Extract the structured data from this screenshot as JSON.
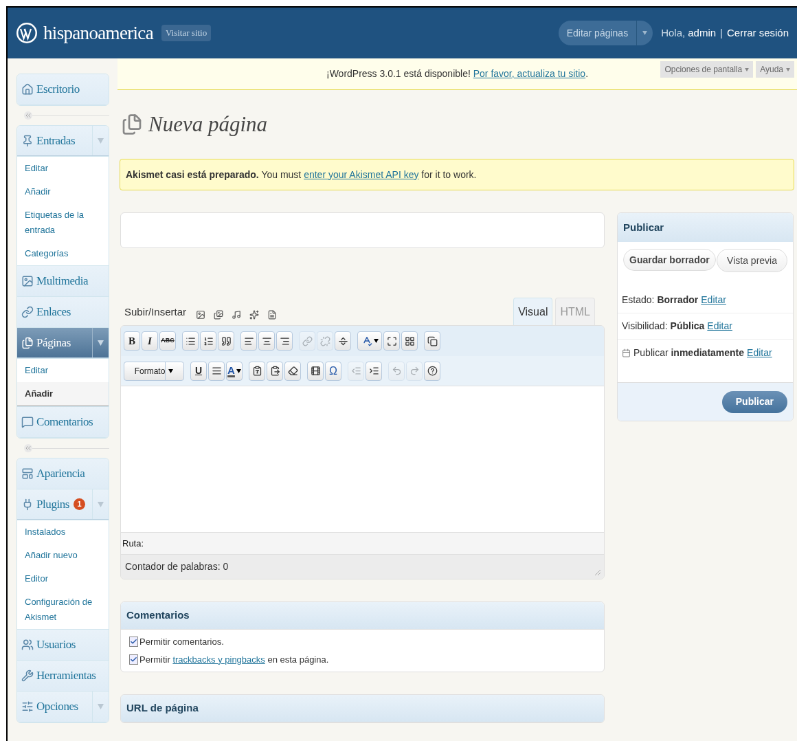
{
  "header": {
    "site_name": "hispanoamerica",
    "visit_site": "Visitar sitio",
    "favorite_action": "Editar páginas",
    "greeting": "Hola,",
    "user": "admin",
    "separator": "|",
    "logout": "Cerrar sesión"
  },
  "sidebar": {
    "groups": [
      {
        "items": [
          {
            "label": "Escritorio",
            "selected": false,
            "has_toggle": false,
            "expanded": false
          }
        ]
      },
      {
        "items": [
          {
            "label": "Entradas",
            "selected": false,
            "has_toggle": true,
            "expanded": true,
            "children": [
              {
                "label": "Editar",
                "selected": false
              },
              {
                "label": "Añadir",
                "selected": false
              },
              {
                "label": "Etiquetas de la entrada",
                "selected": false
              },
              {
                "label": "Categorías",
                "selected": false
              }
            ]
          },
          {
            "label": "Multimedia",
            "selected": false,
            "has_toggle": false,
            "expanded": false
          },
          {
            "label": "Enlaces",
            "selected": false,
            "has_toggle": false,
            "expanded": false
          },
          {
            "label": "Páginas",
            "selected": true,
            "has_toggle": true,
            "expanded": true,
            "children": [
              {
                "label": "Editar",
                "selected": false
              },
              {
                "label": "Añadir",
                "selected": true
              }
            ]
          },
          {
            "label": "Comentarios",
            "selected": false,
            "has_toggle": false,
            "expanded": false
          }
        ]
      },
      {
        "items": [
          {
            "label": "Apariencia",
            "selected": false,
            "has_toggle": false,
            "expanded": false
          },
          {
            "label": "Plugins",
            "selected": false,
            "has_toggle": true,
            "expanded": true,
            "badge": "1",
            "children": [
              {
                "label": "Instalados",
                "selected": false
              },
              {
                "label": "Añadir nuevo",
                "selected": false
              },
              {
                "label": "Editor",
                "selected": false
              },
              {
                "label": "Configuración de Akismet",
                "selected": false
              }
            ]
          },
          {
            "label": "Usuarios",
            "selected": false,
            "has_toggle": false,
            "expanded": false
          },
          {
            "label": "Herramientas",
            "selected": false,
            "has_toggle": false,
            "expanded": false
          },
          {
            "label": "Opciones",
            "selected": false,
            "has_toggle": true,
            "expanded": false
          }
        ]
      }
    ]
  },
  "update_nag": {
    "text": "¡WordPress 3.0.1 está disponible!",
    "link": "Por favor, actualiza tu sitio",
    "after": "."
  },
  "screen_meta": [
    "Opciones de pantalla",
    "Ayuda"
  ],
  "page_title": "Nueva página",
  "notice": {
    "text": "**Akismet casi está preparado.** You must",
    "link": "enter your Akismet API key",
    "after": "for it to work."
  },
  "editor": {
    "upload_label": "Subir/Insertar",
    "tabs": [
      {
        "label": "Visual",
        "selected": true
      },
      {
        "label": "HTML",
        "selected": false
      }
    ],
    "toolbar_rows": [
      [
        [
          {
            "kind": "bold",
            "label": "B",
            "disabled": false
          },
          {
            "kind": "italic",
            "label": "I",
            "disabled": false
          },
          {
            "kind": "strike",
            "label": "ABC",
            "disabled": false
          }
        ],
        [
          {
            "kind": "bullets",
            "disabled": false
          },
          {
            "kind": "numbered",
            "disabled": false
          },
          {
            "kind": "quote",
            "disabled": false
          }
        ],
        [
          {
            "kind": "alignleft",
            "disabled": false
          },
          {
            "kind": "aligncenter",
            "disabled": false
          },
          {
            "kind": "alignright",
            "disabled": false
          }
        ],
        [
          {
            "kind": "link",
            "disabled": true
          },
          {
            "kind": "unlink",
            "disabled": true
          },
          {
            "kind": "more",
            "disabled": false
          }
        ],
        [
          {
            "kind": "spell",
            "disabled": false
          },
          {
            "kind": "fullscreen",
            "disabled": false
          },
          {
            "kind": "kitchen",
            "disabled": false
          }
        ],
        [
          {
            "kind": "pages",
            "disabled": false
          }
        ]
      ],
      [
        [
          {
            "kind": "select",
            "label": "Formato",
            "disabled": false
          }
        ],
        [
          {
            "kind": "underline",
            "label": "U",
            "disabled": false
          },
          {
            "kind": "justify",
            "disabled": false
          },
          {
            "kind": "fontcolor",
            "label": "A",
            "disabled": false
          }
        ],
        [
          {
            "kind": "pastetext",
            "disabled": false
          },
          {
            "kind": "pasteword",
            "disabled": false
          },
          {
            "kind": "eraser",
            "disabled": false
          }
        ],
        [
          {
            "kind": "film",
            "disabled": false
          },
          {
            "kind": "charmap",
            "label": "Ω",
            "disabled": false
          }
        ],
        [
          {
            "kind": "outdent",
            "disabled": true
          },
          {
            "kind": "indent",
            "disabled": false
          }
        ],
        [
          {
            "kind": "undo",
            "disabled": true
          },
          {
            "kind": "redo",
            "disabled": true
          },
          {
            "kind": "help",
            "disabled": false
          }
        ]
      ]
    ],
    "path_label": "Ruta:",
    "word_count": "Contador de palabras: 0"
  },
  "publish": {
    "title": "Publicar",
    "save_draft": "Guardar borrador",
    "preview": "Vista previa",
    "rows": [
      {
        "kind": "plain",
        "label": "Estado:",
        "value": "Borrador",
        "action": "Editar"
      },
      {
        "kind": "plain",
        "label": "Visibilidad:",
        "value": "Pública",
        "action": "Editar"
      },
      {
        "kind": "schedule",
        "label": "Publicar",
        "value": "inmediatamente",
        "action": "Editar"
      }
    ],
    "submit": "Publicar"
  },
  "comments_box": {
    "title": "Comentarios",
    "options": [
      {
        "checked": true,
        "text": "Permitir comentarios."
      },
      {
        "checked": true,
        "text": "Permitir",
        "link": "trackbacks y pingbacks",
        "after": "en esta página."
      }
    ]
  },
  "url_box": {
    "title": "URL de página"
  }
}
